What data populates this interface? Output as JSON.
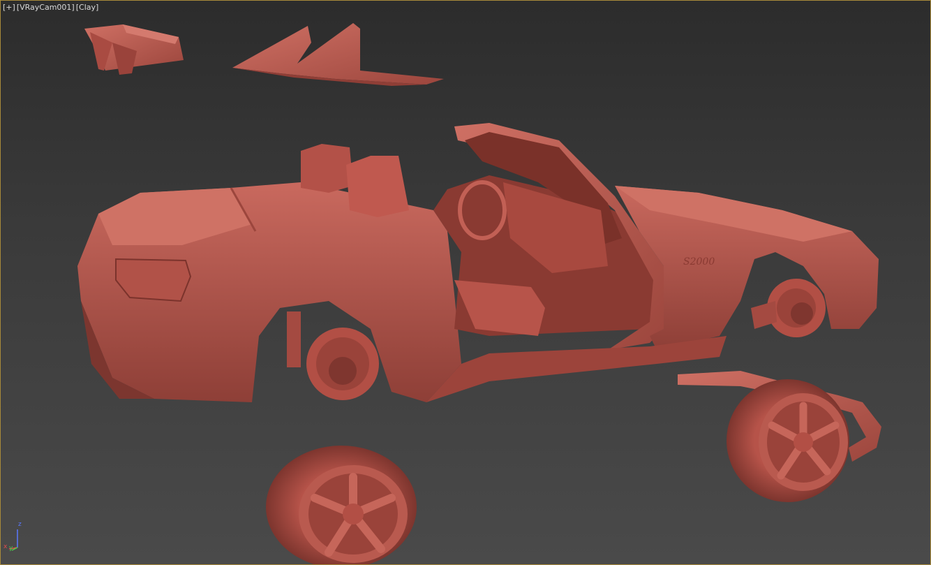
{
  "viewport": {
    "labels": {
      "plus": "[+]",
      "camera": "[VRayCam001]",
      "shading": "[Clay]"
    },
    "shading_color": "#b7564c",
    "background_top": "#2c2c2c",
    "background_bottom": "#4a4a4a",
    "active_border_color": "#a88a3a"
  },
  "axis_gizmo": {
    "z": "z",
    "x": "x",
    "y": "y",
    "z_color": "#5a78ff",
    "x_color": "#e24c4c",
    "y_color": "#4ccf4c"
  },
  "scene": {
    "objects": [
      "rear-spoiler-piece",
      "front-lip-piece",
      "car-body",
      "front-wheel",
      "rear-wheel",
      "side-skirt-piece",
      "rear-brake-assembly",
      "front-brake-assembly"
    ],
    "badge_text": "S2000"
  }
}
